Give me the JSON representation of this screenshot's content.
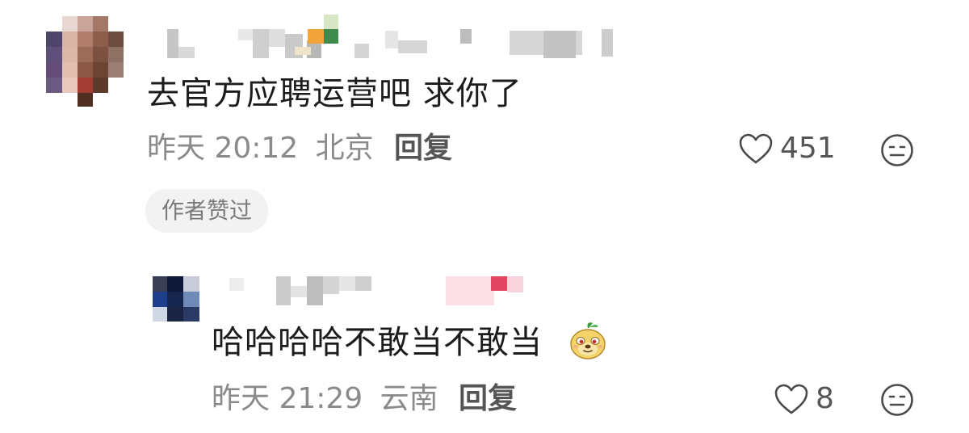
{
  "comment": {
    "text": "去官方应聘运营吧 求你了",
    "time": "昨天 20:12",
    "location": "北京",
    "reply_label": "回复",
    "like_count": "451",
    "badge": "作者赞过"
  },
  "reply": {
    "text": "哈哈哈哈不敢当不敢当",
    "emoji_icon": "doge-face-emoji",
    "time": "昨天 21:29",
    "location": "云南",
    "reply_label": "回复",
    "like_count": "8"
  },
  "colors": {
    "meta_text": "#8a8a8a",
    "body_text": "#1c1c1c",
    "badge_bg": "#f2f2f2"
  }
}
